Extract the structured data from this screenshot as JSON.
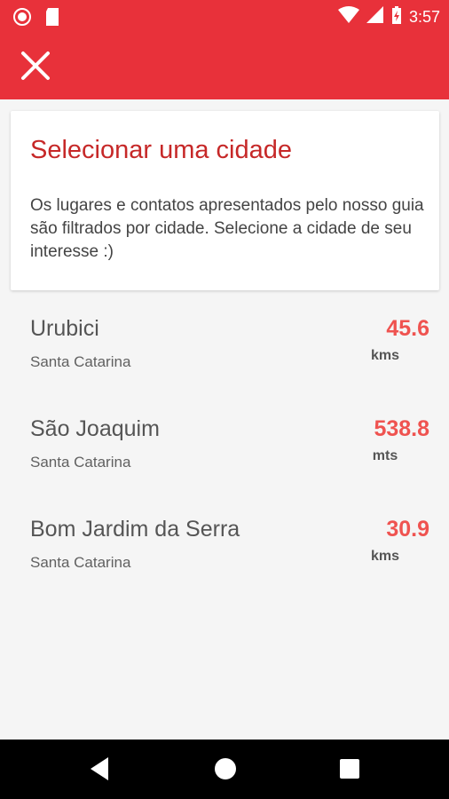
{
  "status_bar": {
    "time": "3:57",
    "icons": [
      "record-icon",
      "sd-card-icon",
      "wifi-icon",
      "signal-icon",
      "battery-charging-icon"
    ]
  },
  "app_bar": {
    "close_icon": "close-icon"
  },
  "header_card": {
    "title": "Selecionar uma cidade",
    "description": "Os lugares e contatos apresentados pelo nosso guia são filtrados por cidade. Selecione a cidade de seu interesse :)"
  },
  "cities": [
    {
      "name": "Urubici",
      "state": "Santa Catarina",
      "distance": "45.6",
      "unit": "kms"
    },
    {
      "name": "São Joaquim",
      "state": "Santa Catarina",
      "distance": "538.8",
      "unit": "mts"
    },
    {
      "name": "Bom Jardim da Serra",
      "state": "Santa Catarina",
      "distance": "30.9",
      "unit": "kms"
    }
  ],
  "nav_bar": {
    "icons": [
      "back-icon",
      "home-icon",
      "recents-icon"
    ]
  },
  "colors": {
    "accent": "#e8313a",
    "title": "#c62828",
    "distance": "#ef5350"
  }
}
